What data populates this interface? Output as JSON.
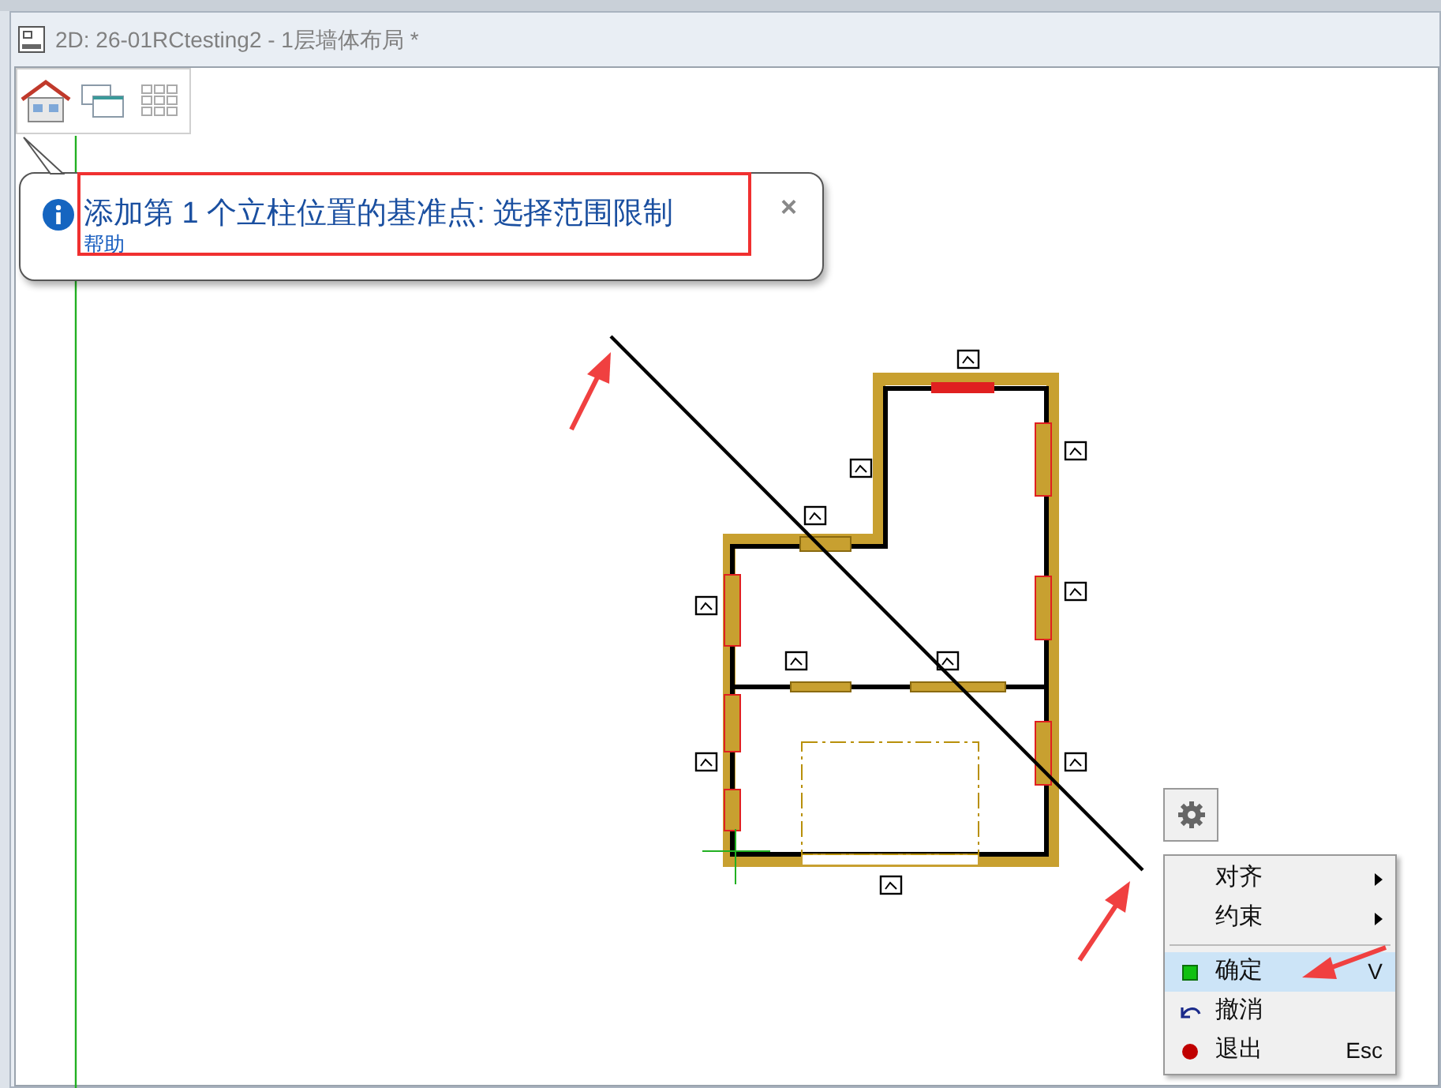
{
  "window": {
    "title": "2D: 26-01RCtesting2 - 1层墙体布局 *"
  },
  "tooltip": {
    "message": "添加第 1 个立柱位置的基准点: 选择范围限制",
    "link": "帮助",
    "close": "×"
  },
  "context_menu": {
    "items": [
      {
        "kind": "submenu",
        "label": "对齐",
        "selected": false
      },
      {
        "kind": "submenu",
        "label": "约束",
        "selected": false
      },
      {
        "kind": "separator"
      },
      {
        "kind": "confirm",
        "label": "确定",
        "shortcut": "V",
        "selected": true
      },
      {
        "kind": "undo",
        "label": "撤消",
        "selected": false
      },
      {
        "kind": "exit",
        "label": "退出",
        "shortcut": "Esc",
        "selected": false
      }
    ]
  }
}
